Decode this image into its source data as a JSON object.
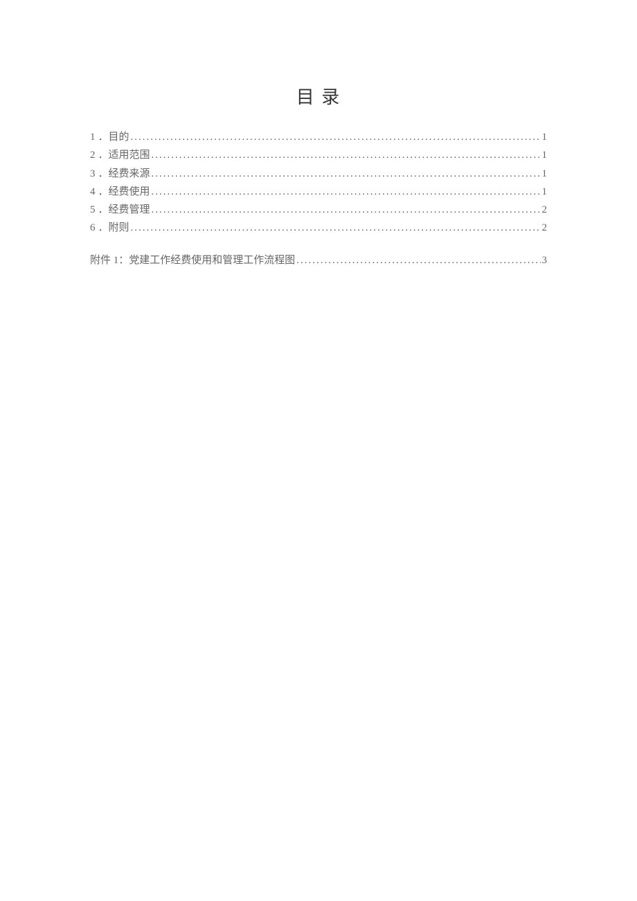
{
  "title": "目 录",
  "toc": [
    {
      "num": "1",
      "label": "．目的",
      "page": "1"
    },
    {
      "num": "2",
      "label": "．适用范围",
      "page": "1"
    },
    {
      "num": "3",
      "label": "．经费来源",
      "page": "1"
    },
    {
      "num": "4",
      "label": "．经费使用",
      "page": "1"
    },
    {
      "num": "5",
      "label": "．经费管理",
      "page": "2"
    },
    {
      "num": "6",
      "label": "．附则",
      "page": "2"
    }
  ],
  "appendix": {
    "label": "附件 1：党建工作经费使用和管理工作流程图",
    "page": "3"
  }
}
